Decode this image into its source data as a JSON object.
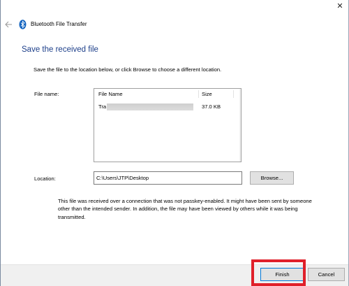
{
  "window": {
    "title": "Bluetooth File Transfer",
    "close_symbol": "✕"
  },
  "page": {
    "heading": "Save the received file",
    "description": "Save the file to the location below, or click Browse to choose a different location."
  },
  "file_section": {
    "label": "File name:",
    "columns": [
      "File Name",
      "Size"
    ],
    "rows": [
      {
        "name_visible": "Tra",
        "size": "37.0 KB"
      }
    ]
  },
  "location": {
    "label": "Location:",
    "value": "C:\\Users\\JTP\\Desktop",
    "browse_label": "Browse..."
  },
  "warning_text": "This file was received over a connection that was not passkey-enabled. It might have been sent by someone other than the intended sender. In addition, the file may have been viewed by others while it was being transmitted.",
  "footer": {
    "finish_label": "Finish",
    "cancel_label": "Cancel"
  },
  "colors": {
    "heading": "#1d3f8a",
    "highlight": "#e0202a",
    "default_button_border": "#0078d7"
  },
  "icons": {
    "back": "back-arrow-icon",
    "bluetooth": "bluetooth-icon",
    "close": "close-icon"
  }
}
